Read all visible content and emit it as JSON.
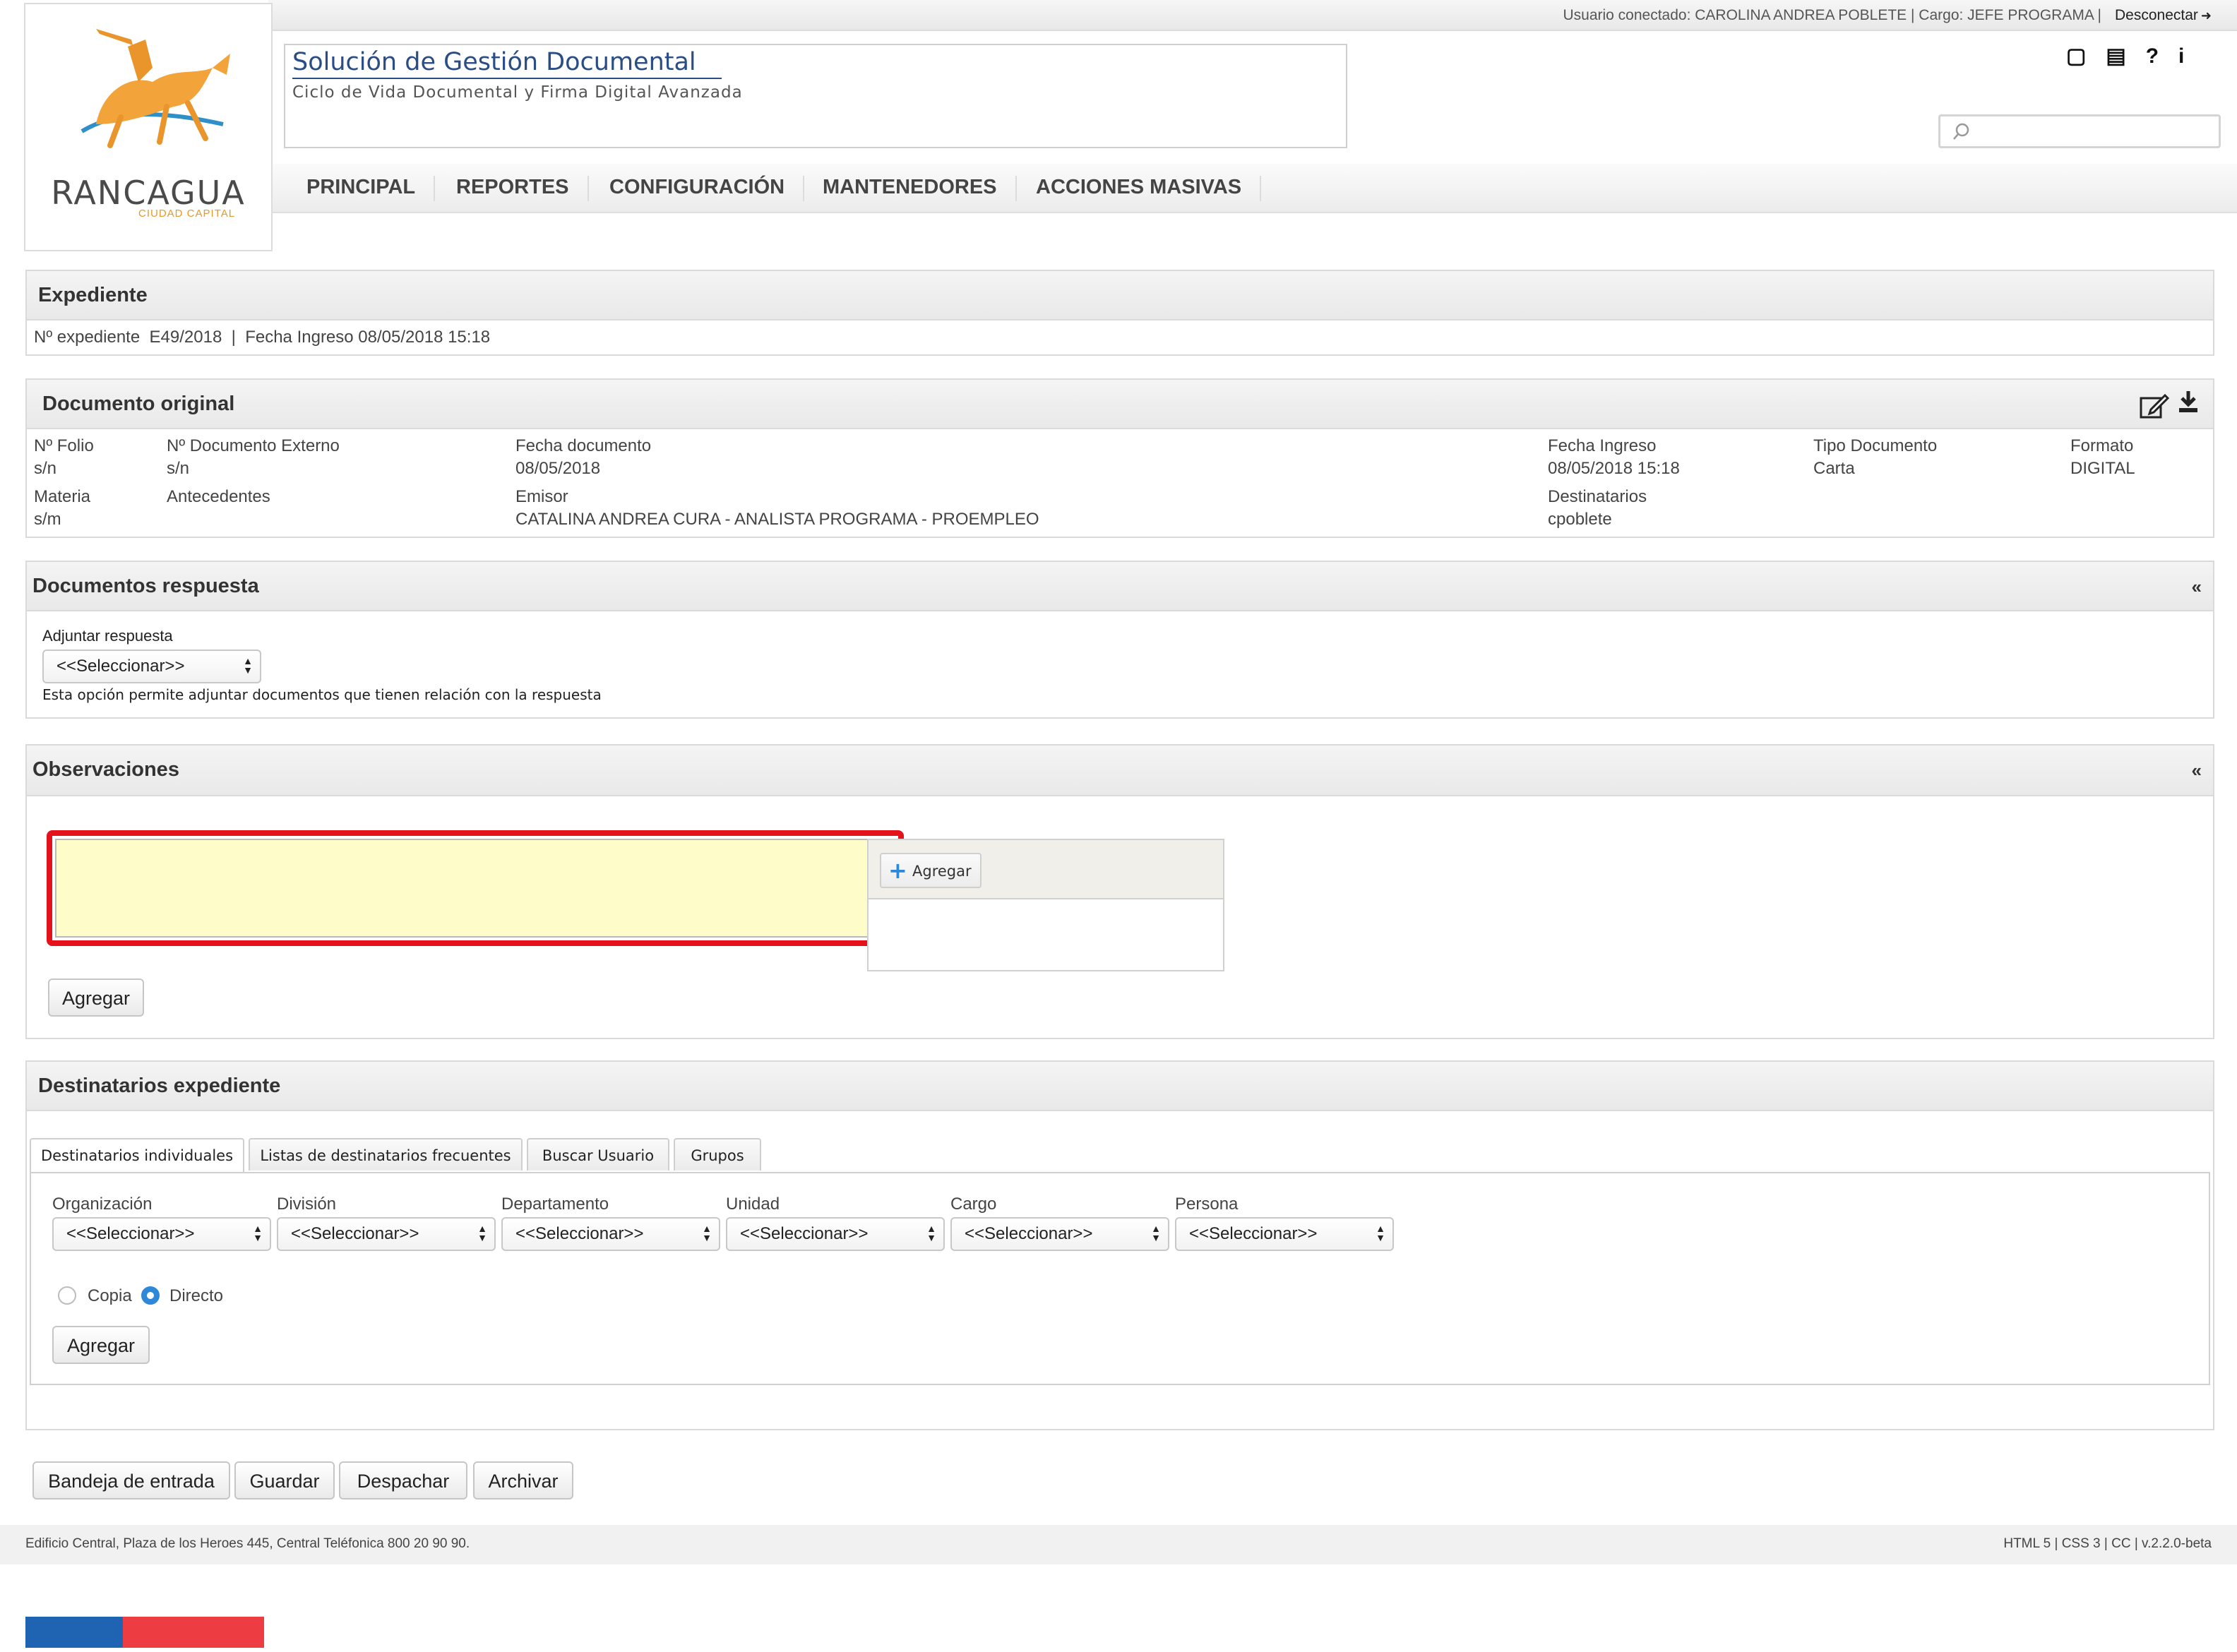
{
  "userbar": {
    "user_text": "Usuario conectado: CAROLINA ANDREA POBLETE | Cargo: JEFE PROGRAMA |",
    "logout_label": "Desconectar"
  },
  "logo": {
    "name": "RANCAGUA",
    "subtitle": "CIUDAD CAPITAL"
  },
  "header": {
    "title": "Solución de Gestión Documental",
    "subtitle": "Ciclo de Vida Documental y Firma Digital Avanzada"
  },
  "top_icons": [
    "book-icon",
    "newspaper-icon",
    "help-icon",
    "info-icon"
  ],
  "nav": {
    "items": [
      "PRINCIPAL",
      "REPORTES",
      "CONFIGURACIÓN",
      "MANTENEDORES",
      "ACCIONES MASIVAS"
    ]
  },
  "expediente": {
    "title": "Expediente",
    "info": "Nº expediente  E49/2018  |  Fecha Ingreso 08/05/2018 15:18"
  },
  "documento_original": {
    "title": "Documento original",
    "fields": {
      "folio_label": "Nº Folio",
      "folio_value": "s/n",
      "doc_externo_label": "Nº Documento Externo",
      "doc_externo_value": "s/n",
      "fecha_doc_label": "Fecha documento",
      "fecha_doc_value": "08/05/2018",
      "fecha_ingreso_label": "Fecha Ingreso",
      "fecha_ingreso_value": "08/05/2018 15:18",
      "tipo_label": "Tipo Documento",
      "tipo_value": "Carta",
      "formato_label": "Formato",
      "formato_value": "DIGITAL",
      "materia_label": "Materia",
      "materia_value": "s/m",
      "antecedentes_label": "Antecedentes",
      "emisor_label": "Emisor",
      "emisor_value": "CATALINA ANDREA CURA - ANALISTA PROGRAMA - PROEMPLEO",
      "destinatarios_label": "Destinatarios",
      "destinatarios_value": "cpoblete"
    }
  },
  "documentos_respuesta": {
    "title": "Documentos respuesta",
    "collapse": "«",
    "adjuntar_label": "Adjuntar respuesta",
    "select_value": "<<Seleccionar>>",
    "help": "Esta opción permite adjuntar documentos que tienen relación con la respuesta"
  },
  "observaciones": {
    "title": "Observaciones",
    "collapse": "«",
    "textarea_value": "",
    "attach_button": "Agregar",
    "add_button": "Agregar"
  },
  "destinatarios": {
    "title": "Destinatarios expediente",
    "tabs": [
      "Destinatarios individuales",
      "Listas de destinatarios frecuentes",
      "Buscar Usuario",
      "Grupos"
    ],
    "fields": [
      {
        "label": "Organización",
        "value": "<<Seleccionar>>"
      },
      {
        "label": "División",
        "value": "<<Seleccionar>>"
      },
      {
        "label": "Departamento",
        "value": "<<Seleccionar>>"
      },
      {
        "label": "Unidad",
        "value": "<<Seleccionar>>"
      },
      {
        "label": "Cargo",
        "value": "<<Seleccionar>>"
      },
      {
        "label": "Persona",
        "value": "<<Seleccionar>>"
      }
    ],
    "radio_copia": "Copia",
    "radio_directo": "Directo",
    "add_button": "Agregar"
  },
  "actions": {
    "bandeja": "Bandeja de entrada",
    "guardar": "Guardar",
    "despachar": "Despachar",
    "archivar": "Archivar"
  },
  "footer": {
    "address": "Edificio Central, Plaza de los Heroes 445, Central Teléfonica 800 20 90 90.",
    "meta": "HTML 5 | CSS 3 | CC | v.2.2.0-beta"
  },
  "colors": {
    "brand_blue": "#2a4d86",
    "highlight_red": "#e5121c",
    "textarea_bg": "#fefdca",
    "flag_blue": "#1f63b3",
    "flag_red": "#ee3d42"
  }
}
